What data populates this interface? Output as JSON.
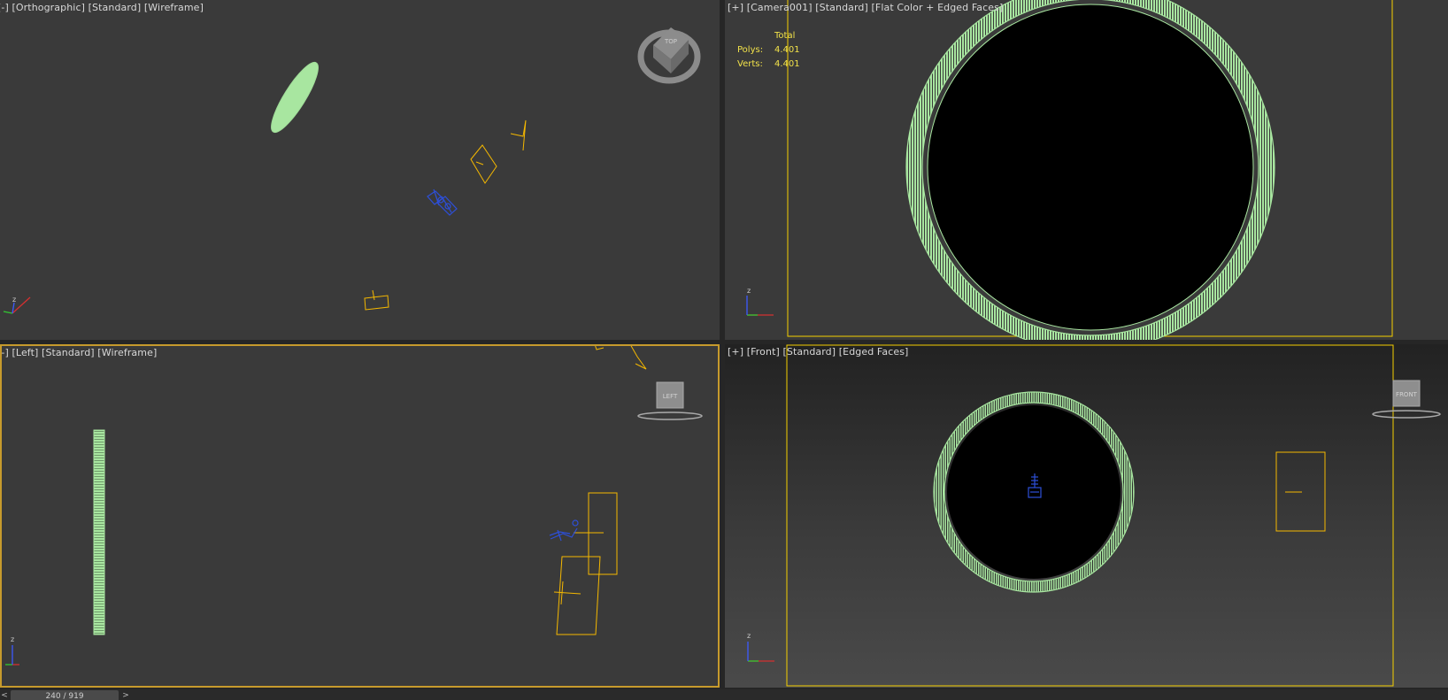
{
  "viewports": {
    "top_left": {
      "labels": [
        "-",
        "Orthographic",
        "Standard",
        "Wireframe"
      ]
    },
    "top_right": {
      "labels": [
        "+",
        "Camera001",
        "Standard",
        "Flat Color + Edged Faces"
      ],
      "stats": {
        "header": "Total",
        "polys_label": "Polys:",
        "polys_value": "4.401",
        "verts_label": "Verts:",
        "verts_value": "4.401"
      }
    },
    "bottom_left": {
      "labels": [
        "-",
        "Left",
        "Standard",
        "Wireframe"
      ],
      "viewcube_label": "LEFT"
    },
    "bottom_right": {
      "labels": [
        "+",
        "Front",
        "Standard",
        "Edged Faces"
      ],
      "viewcube_label": "FRONT"
    }
  },
  "viewcube_top_label": "TOP",
  "axis_label": "z",
  "time_slider": {
    "label": "240 / 919",
    "prev_icon": "<",
    "next_icon": ">"
  },
  "colors": {
    "selection_green": "#a8e6a0",
    "object_yellow": "#f5b800",
    "camera_blue": "#2d4fd9",
    "axis_x": "#d43030",
    "axis_y": "#32c832",
    "axis_z": "#3c5aff",
    "viewport_bg": "#3a3a3a",
    "active_border": "#c69a2c"
  }
}
